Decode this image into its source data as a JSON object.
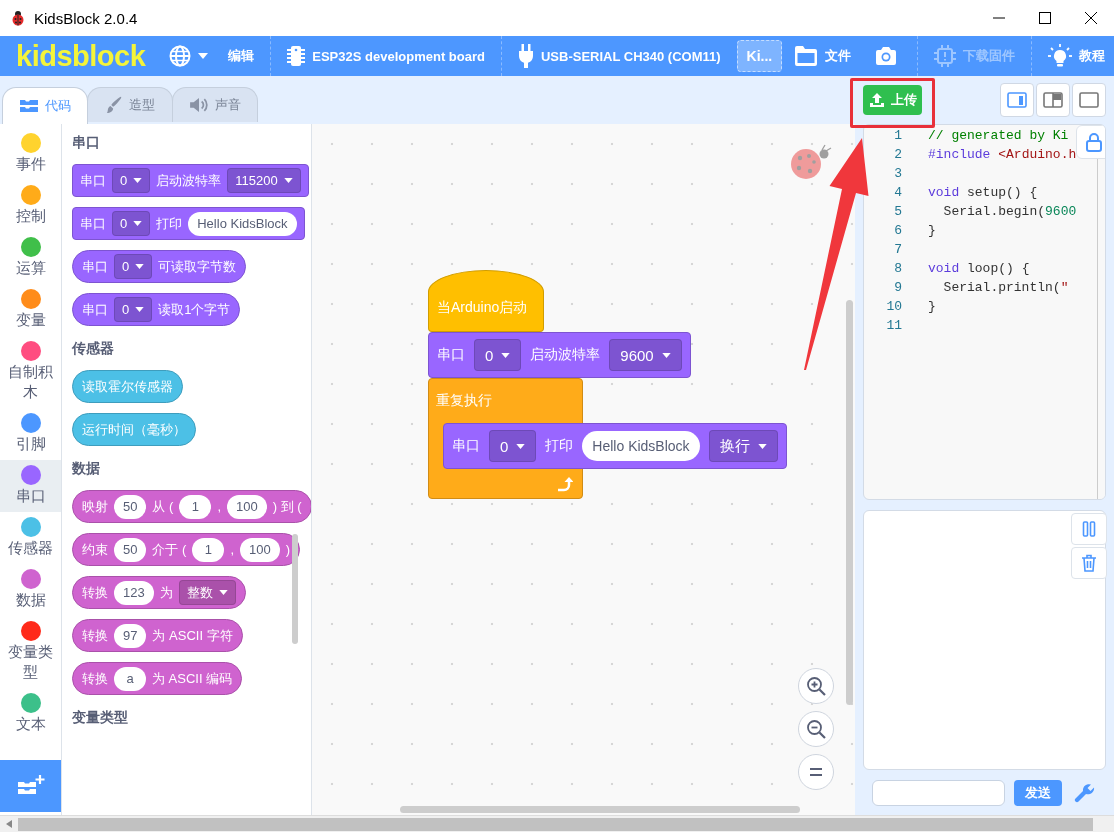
{
  "window": {
    "title": "KidsBlock 2.0.4"
  },
  "menu_bar": {
    "logo": "kidsblock",
    "items": [
      {
        "kind": "language",
        "disabled": false
      },
      {
        "kind": "text",
        "label": "编辑",
        "disabled": false
      },
      {
        "kind": "divider"
      },
      {
        "kind": "board",
        "label": "ESP32S development board",
        "disabled": false
      },
      {
        "kind": "divider"
      },
      {
        "kind": "port",
        "label": "USB-SERIAL CH340 (COM11)",
        "disabled": false
      },
      {
        "kind": "project",
        "label": "Ki...",
        "disabled": false
      },
      {
        "kind": "file",
        "label": "文件",
        "disabled": false
      },
      {
        "kind": "camera",
        "disabled": false
      },
      {
        "kind": "divider"
      },
      {
        "kind": "firmware",
        "label": "下载固件",
        "disabled": true
      },
      {
        "kind": "divider"
      },
      {
        "kind": "tutorial",
        "label": "教程",
        "disabled": false
      }
    ]
  },
  "tabs": [
    {
      "label": "代码",
      "kind": "code",
      "selected": true
    },
    {
      "label": "造型",
      "kind": "costume",
      "selected": false
    },
    {
      "label": "声音",
      "kind": "sound",
      "selected": false
    }
  ],
  "upload_button": {
    "label": "上传"
  },
  "view_buttons": [
    {
      "kind": "side",
      "selected": true
    },
    {
      "kind": "split",
      "selected": false
    },
    {
      "kind": "full",
      "selected": false
    }
  ],
  "categories": [
    {
      "label": "事件",
      "color": "#ffd32e",
      "selected": false
    },
    {
      "label": "控制",
      "color": "#ffab19",
      "selected": false
    },
    {
      "label": "运算",
      "color": "#40bf4a",
      "selected": false
    },
    {
      "label": "变量",
      "color": "#ff8c1a",
      "selected": false
    },
    {
      "label": "自制积木",
      "color": "#ff4d80",
      "selected": false
    },
    {
      "label": "引脚",
      "color": "#4c97ff",
      "selected": false
    },
    {
      "label": "串口",
      "color": "#9966ff",
      "selected": true
    },
    {
      "label": "传感器",
      "color": "#4cc0e6",
      "selected": false
    },
    {
      "label": "数据",
      "color": "#cf63cf",
      "selected": false
    },
    {
      "label": "变量类型",
      "color": "#ff2a1a",
      "selected": false
    },
    {
      "label": "文本",
      "color": "#3cc08a",
      "selected": false
    }
  ],
  "palette": {
    "sections": [
      {
        "title": "串口",
        "color": "#9966ff",
        "blocks": [
          {
            "kind": "command",
            "parts": [
              {
                "kind": "label",
                "text": "串口"
              },
              {
                "kind": "dropdown",
                "text": "0"
              },
              {
                "kind": "label",
                "text": "启动波特率"
              },
              {
                "kind": "dropdown",
                "text": "115200"
              }
            ]
          },
          {
            "kind": "command",
            "parts": [
              {
                "kind": "label",
                "text": "串口"
              },
              {
                "kind": "dropdown",
                "text": "0"
              },
              {
                "kind": "label",
                "text": "打印"
              },
              {
                "kind": "input",
                "text": "Hello KidsBlock"
              }
            ]
          },
          {
            "kind": "reporter",
            "parts": [
              {
                "kind": "label",
                "text": "串口"
              },
              {
                "kind": "dropdown",
                "text": "0"
              },
              {
                "kind": "label",
                "text": "可读取字节数"
              }
            ]
          },
          {
            "kind": "reporter",
            "parts": [
              {
                "kind": "label",
                "text": "串口"
              },
              {
                "kind": "dropdown",
                "text": "0"
              },
              {
                "kind": "label",
                "text": "读取1个字节"
              }
            ]
          }
        ]
      },
      {
        "title": "传感器",
        "color": "#4cc0e6",
        "blocks": [
          {
            "kind": "reporter",
            "parts": [
              {
                "kind": "label",
                "text": "读取霍尔传感器"
              }
            ]
          },
          {
            "kind": "reporter",
            "parts": [
              {
                "kind": "label",
                "text": "运行时间（毫秒）"
              }
            ]
          }
        ]
      },
      {
        "title": "数据",
        "color": "#cf63cf",
        "blocks": [
          {
            "kind": "reporter",
            "parts": [
              {
                "kind": "label",
                "text": "映射"
              },
              {
                "kind": "input",
                "text": "50"
              },
              {
                "kind": "label",
                "text": "从 ("
              },
              {
                "kind": "input",
                "text": "1"
              },
              {
                "kind": "label",
                "text": ","
              },
              {
                "kind": "input",
                "text": "100"
              },
              {
                "kind": "label",
                "text": ") 到 ("
              }
            ]
          },
          {
            "kind": "reporter",
            "parts": [
              {
                "kind": "label",
                "text": "约束"
              },
              {
                "kind": "input",
                "text": "50"
              },
              {
                "kind": "label",
                "text": "介于 ("
              },
              {
                "kind": "input",
                "text": "1"
              },
              {
                "kind": "label",
                "text": ","
              },
              {
                "kind": "input",
                "text": "100"
              },
              {
                "kind": "label",
                "text": ")"
              }
            ]
          },
          {
            "kind": "reporter",
            "parts": [
              {
                "kind": "label",
                "text": "转换"
              },
              {
                "kind": "input",
                "text": "123"
              },
              {
                "kind": "label",
                "text": "为"
              },
              {
                "kind": "dropdown",
                "text": "整数"
              }
            ]
          },
          {
            "kind": "reporter",
            "parts": [
              {
                "kind": "label",
                "text": "转换"
              },
              {
                "kind": "input",
                "text": "97"
              },
              {
                "kind": "label",
                "text": "为 ASCII 字符"
              }
            ]
          },
          {
            "kind": "reporter",
            "parts": [
              {
                "kind": "label",
                "text": "转换"
              },
              {
                "kind": "input",
                "text": "a"
              },
              {
                "kind": "label",
                "text": "为 ASCII 编码"
              }
            ]
          }
        ]
      },
      {
        "title": "变量类型"
      }
    ]
  },
  "canvas": {
    "script": [
      {
        "kind": "hat",
        "color": "#ffbf00",
        "parts": [
          {
            "kind": "label",
            "text": "当Arduino启动"
          }
        ]
      },
      {
        "kind": "command",
        "color": "#9966ff",
        "parts": [
          {
            "kind": "label",
            "text": "串口"
          },
          {
            "kind": "dropdown",
            "text": "0"
          },
          {
            "kind": "label",
            "text": "启动波特率"
          },
          {
            "kind": "dropdown",
            "text": "9600"
          }
        ]
      },
      {
        "kind": "loop",
        "color": "#ffab19",
        "parts": [
          {
            "kind": "label",
            "text": "重复执行"
          }
        ],
        "children": [
          {
            "kind": "command",
            "color": "#9966ff",
            "parts": [
              {
                "kind": "label",
                "text": "串口"
              },
              {
                "kind": "dropdown",
                "text": "0"
              },
              {
                "kind": "label",
                "text": "打印"
              },
              {
                "kind": "input",
                "text": "Hello KidsBlock"
              },
              {
                "kind": "dropdown",
                "text": "换行"
              }
            ]
          }
        ]
      }
    ]
  },
  "code_editor": {
    "lines": [
      {
        "number": "1",
        "tokens": [
          {
            "kind": "comment",
            "text": "// generated by Ki"
          }
        ]
      },
      {
        "number": "2",
        "tokens": [
          {
            "kind": "keyword",
            "text": "#include"
          },
          {
            "kind": "string",
            "text": " <Arduino.h"
          }
        ]
      },
      {
        "number": "3"
      },
      {
        "number": "4",
        "tokens": [
          {
            "kind": "keyword",
            "text": "void"
          },
          {
            "kind": "plain",
            "text": " setup() {"
          }
        ]
      },
      {
        "number": "5",
        "tokens": [
          {
            "kind": "plain",
            "text": "  Serial.begin("
          },
          {
            "kind": "number",
            "text": "9600"
          }
        ]
      },
      {
        "number": "6",
        "tokens": [
          {
            "kind": "plain",
            "text": "}"
          }
        ]
      },
      {
        "number": "7"
      },
      {
        "number": "8",
        "tokens": [
          {
            "kind": "keyword",
            "text": "void"
          },
          {
            "kind": "plain",
            "text": " loop() {"
          }
        ]
      },
      {
        "number": "9",
        "tokens": [
          {
            "kind": "plain",
            "text": "  Serial.println("
          },
          {
            "kind": "string",
            "text": "\""
          }
        ]
      },
      {
        "number": "10",
        "tokens": [
          {
            "kind": "plain",
            "text": "}"
          }
        ]
      },
      {
        "number": "11"
      }
    ]
  },
  "serial_monitor": {
    "send_button": "发送"
  },
  "annotations": {
    "highlight_box": true,
    "arrow": true
  }
}
